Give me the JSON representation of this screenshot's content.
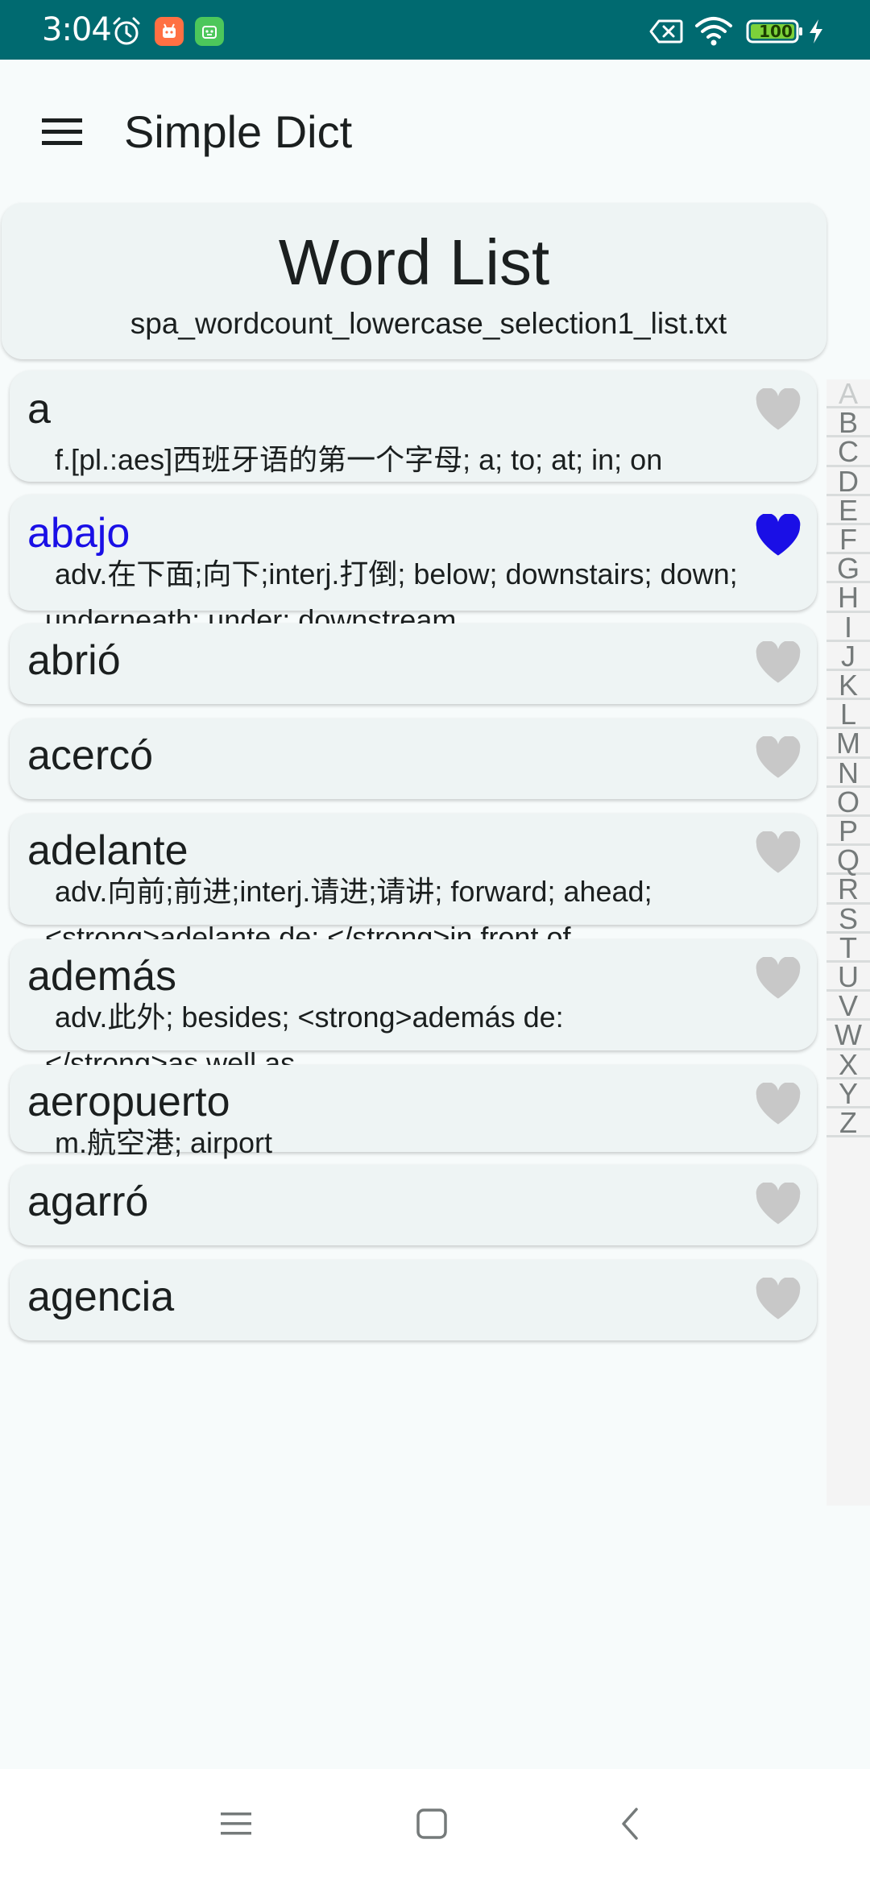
{
  "status_bar": {
    "time": "3:04",
    "battery": "100",
    "icons": [
      "alarm-icon",
      "app-notification-icon",
      "app-notification-icon",
      "no-sim-icon",
      "wifi-icon",
      "battery-icon",
      "charging-icon"
    ]
  },
  "app_bar": {
    "title": "Simple Dict",
    "menu_icon": "hamburger-menu-icon"
  },
  "header": {
    "title": "Word List",
    "filename": "spa_wordcount_lowercase_selection1_list.txt"
  },
  "words": [
    {
      "term": "a",
      "definition": "f.[pl.:aes]西班牙语的第一个字母; a; to; at; in; on",
      "favorite": false
    },
    {
      "term": "abajo",
      "definition": "adv.在下面;向下;interj.打倒; below; downstairs; down; underneath; under; downstream",
      "favorite": true
    },
    {
      "term": "abrió",
      "definition": "",
      "favorite": false
    },
    {
      "term": "acercó",
      "definition": "",
      "favorite": false
    },
    {
      "term": "adelante",
      "definition": "adv.向前;前进;interj.请进;请讲; forward; ahead; <strong>adelante de: </strong>in front of",
      "favorite": false
    },
    {
      "term": "además",
      "definition": "adv.此外; besides; <strong>además de: </strong>as well as",
      "favorite": false
    },
    {
      "term": "aeropuerto",
      "definition": "m.航空港; airport",
      "favorite": false
    },
    {
      "term": "agarró",
      "definition": "",
      "favorite": false
    },
    {
      "term": "agencia",
      "definition": "",
      "favorite": false
    }
  ],
  "alphabet": [
    "A",
    "B",
    "C",
    "D",
    "E",
    "F",
    "G",
    "H",
    "I",
    "J",
    "K",
    "L",
    "M",
    "N",
    "O",
    "P",
    "Q",
    "R",
    "S",
    "T",
    "U",
    "V",
    "W",
    "X",
    "Y",
    "Z"
  ],
  "alphabet_active": "A",
  "colors": {
    "status_bar": "#006a70",
    "favorite": "#1a0fe6",
    "heart_inactive": "#c8c8c8",
    "card": "#eef4f4"
  },
  "nav_bar": {
    "icons": [
      "recent-apps-icon",
      "home-icon",
      "back-icon"
    ]
  }
}
